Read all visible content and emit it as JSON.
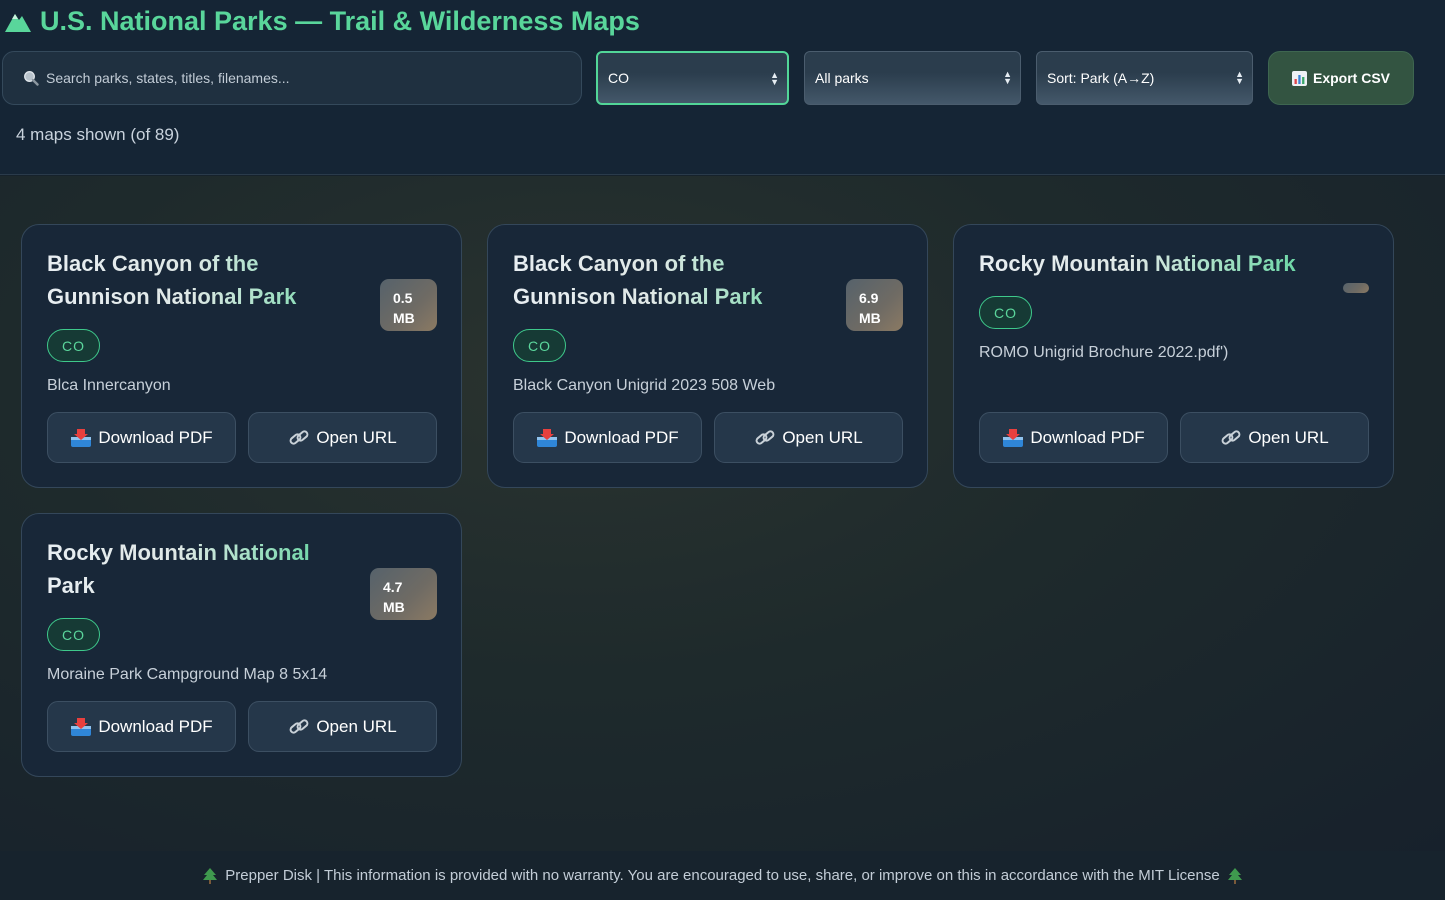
{
  "header": {
    "title": "U.S. National Parks — Trail & Wilderness Maps",
    "search_placeholder": "Search parks, states, titles, filenames...",
    "state_filter": "CO",
    "park_filter": "All parks",
    "sort": "Sort: Park (A→Z)",
    "export_label": "Export CSV",
    "count_text": "4 maps shown (of 89)"
  },
  "cards": [
    {
      "park": "Black Canyon of the Gunnison National Park",
      "size_value": "0.5",
      "size_unit": "MB",
      "state": "CO",
      "file": "Blca Innercanyon",
      "download_label": "Download PDF",
      "url_label": "Open URL"
    },
    {
      "park": "Black Canyon of the Gunnison National Park",
      "size_value": "6.9",
      "size_unit": "MB",
      "state": "CO",
      "file": "Black Canyon Unigrid 2023 508 Web",
      "download_label": "Download PDF",
      "url_label": "Open URL"
    },
    {
      "park": "Rocky Mountain National Park",
      "size_value": "",
      "size_unit": "",
      "state": "CO",
      "file": "ROMO Unigrid Brochure 2022.pdf')",
      "download_label": "Download PDF",
      "url_label": "Open URL"
    },
    {
      "park": "Rocky Mountain National Park",
      "size_value": "4.7",
      "size_unit": "MB",
      "state": "CO",
      "file": "Moraine Park Campground Map 8 5x14",
      "download_label": "Download PDF",
      "url_label": "Open URL"
    }
  ],
  "footer": {
    "text": "Prepper Disk | This information is provided with no warranty. You are encouraged to use, share, or improve on this in accordance with the MIT License"
  },
  "colors": {
    "accent": "#59d69b",
    "background": "#16222c",
    "card": "#182738",
    "export": "#335441"
  },
  "icons": {
    "title": "mountain-icon",
    "search": "search-icon",
    "export": "bar-chart-icon",
    "download": "inbox-tray-icon",
    "url": "link-icon",
    "footer": "evergreen-tree-icon"
  }
}
